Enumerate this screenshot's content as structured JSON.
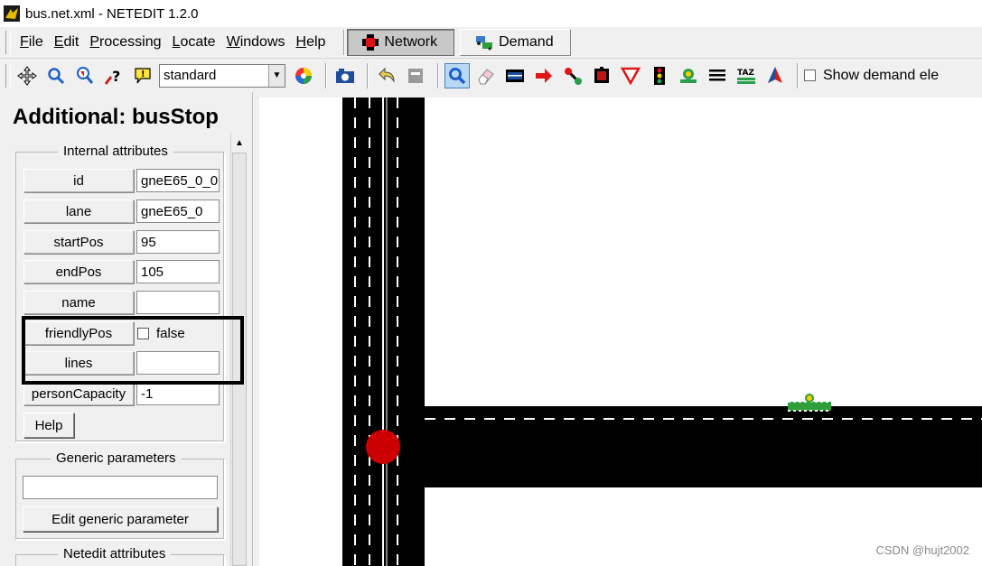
{
  "window": {
    "title": "bus.net.xml - NETEDIT 1.2.0"
  },
  "menu": {
    "items": [
      "File",
      "Edit",
      "Processing",
      "Locate",
      "Windows",
      "Help"
    ],
    "underline": [
      "F",
      "E",
      "P",
      "L",
      "W",
      "H"
    ]
  },
  "modes": {
    "network_label": "Network",
    "demand_label": "Demand",
    "active": "Network"
  },
  "toolbar": {
    "scheme_value": "standard",
    "show_demand_label": "Show demand ele",
    "icons": [
      "recenter-icon",
      "zoom-icon",
      "locate-icon",
      "help-icon",
      "tooltip-icon",
      "color-wheel-icon",
      "screenshot-icon",
      "undo-icon",
      "redo-icon",
      "inspect-icon",
      "delete-icon",
      "select-icon",
      "move-icon",
      "create-edge-icon",
      "connection-icon",
      "prohibition-icon",
      "crossing-icon",
      "traffic-light-icon",
      "additional-icon",
      "wire-icon",
      "taz-icon",
      "polygon-icon"
    ]
  },
  "panel": {
    "title": "Additional: busStop",
    "internal_legend": "Internal attributes",
    "attributes": [
      {
        "label": "id",
        "value": "gneE65_0_0"
      },
      {
        "label": "lane",
        "value": "gneE65_0"
      },
      {
        "label": "startPos",
        "value": "95"
      },
      {
        "label": "endPos",
        "value": "105"
      },
      {
        "label": "name",
        "value": ""
      },
      {
        "label": "friendlyPos",
        "value": "false"
      },
      {
        "label": "lines",
        "value": ""
      },
      {
        "label": "personCapacity",
        "value": "-1"
      }
    ],
    "help_label": "Help",
    "generic_legend": "Generic parameters",
    "generic_value": "",
    "edit_generic_label": "Edit generic parameter",
    "netedit_legend": "Netedit attributes"
  },
  "colors": {
    "road": "#000000",
    "lane_marking": "#ffffff",
    "junction_marker": "#cc0000",
    "bus_stop": "#2e9e3b",
    "highlight_border": "#000000"
  },
  "watermark": "CSDN @hujt2002"
}
